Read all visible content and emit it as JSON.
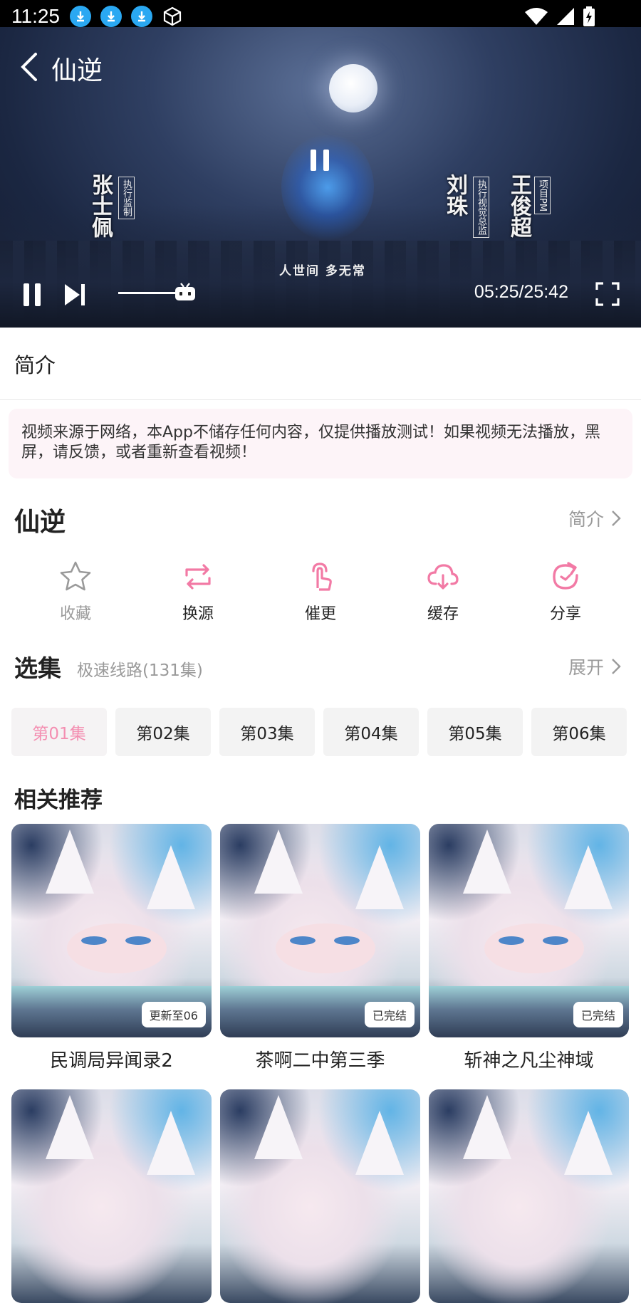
{
  "status_bar": {
    "time": "11:25",
    "notification_icons": [
      "download-icon",
      "download-icon",
      "download-icon",
      "cube-icon"
    ],
    "right_icons": [
      "wifi-icon",
      "signal-icon",
      "battery-charging-icon"
    ]
  },
  "player": {
    "title": "仙逆",
    "credits": {
      "left_name": "张士佩",
      "left_role": "执行监制",
      "right1_name": "刘珠",
      "right1_role": "执行视觉总监",
      "right2_name": "王俊超",
      "right2_role": "项目PM"
    },
    "subtitle": "人世间 多无常",
    "time": "05:25/25:42",
    "progress_fraction": 0.21
  },
  "tabs": {
    "intro": "简介"
  },
  "notice": "视频来源于网络，本App不储存任何内容，仅提供播放测试！如果视频无法播放，黑屏，请反馈，或者重新查看视频！",
  "show": {
    "title": "仙逆",
    "intro_link": "简介"
  },
  "actions": [
    {
      "label": "收藏",
      "icon": "star-icon",
      "color": "#9a9a9a"
    },
    {
      "label": "换源",
      "icon": "swap-icon",
      "color": "#f27aa5"
    },
    {
      "label": "催更",
      "icon": "tap-icon",
      "color": "#f27aa5"
    },
    {
      "label": "缓存",
      "icon": "cloud-download-icon",
      "color": "#f27aa5"
    },
    {
      "label": "分享",
      "icon": "refresh-share-icon",
      "color": "#f27aa5"
    }
  ],
  "episodes_section": {
    "title": "选集",
    "source": "极速线路(131集)",
    "expand": "展开",
    "episodes": [
      "第01集",
      "第02集",
      "第03集",
      "第04集",
      "第05集",
      "第06集"
    ],
    "active_index": 0
  },
  "recommend": {
    "title": "相关推荐",
    "items": [
      {
        "name": "民调局异闻录2",
        "badge": "更新至06"
      },
      {
        "name": "茶啊二中第三季",
        "badge": "已完结"
      },
      {
        "name": "斩神之凡尘神域",
        "badge": "已完结"
      }
    ]
  },
  "colors": {
    "accent": "#f27aa5",
    "muted": "#9a9a9a"
  }
}
